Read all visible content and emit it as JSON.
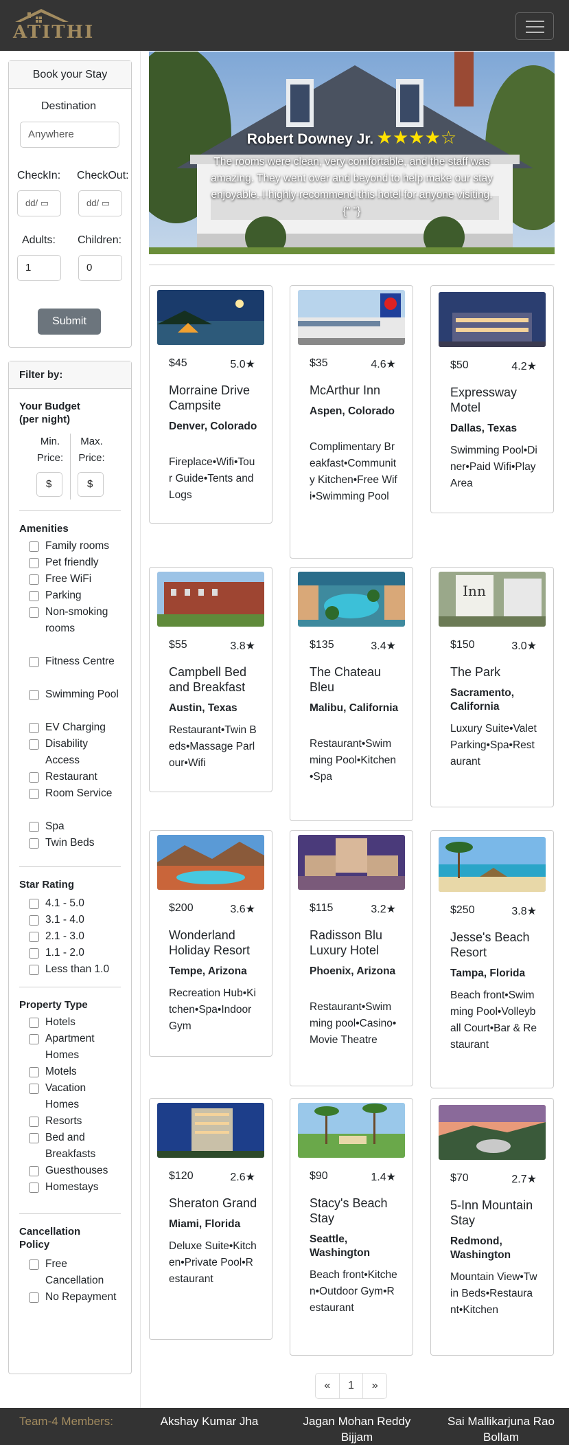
{
  "brand": {
    "name": "ATITHI"
  },
  "booking": {
    "title": "Book your Stay",
    "destination_label": "Destination",
    "destination_placeholder": "Anywhere",
    "checkin_label": "CheckIn:",
    "checkout_label": "CheckOut:",
    "date_placeholder": "dd/",
    "adults_label": "Adults:",
    "adults_value": "1",
    "children_label": "Children:",
    "children_value": "0",
    "submit_label": "Submit"
  },
  "filter": {
    "title": "Filter by:",
    "budget_title": "Your Budget (per night)",
    "min_label": "Min. Price:",
    "max_label": "Max. Price:",
    "currency": "$",
    "amenities_title": "Amenities",
    "amenities": [
      "Family rooms",
      "Pet friendly",
      "Free WiFi",
      "Parking",
      "Non-smoking rooms",
      "Fitness Centre",
      "Swimming Pool",
      "EV Charging",
      "Disability Access",
      "Restaurant",
      "Room Service",
      "Spa",
      "Twin Beds"
    ],
    "star_title": "Star Rating",
    "stars": [
      "4.1 - 5.0",
      "3.1 - 4.0",
      "2.1 - 3.0",
      "1.1 - 2.0",
      "Less than 1.0"
    ],
    "property_title": "Property Type",
    "property_types": [
      "Hotels",
      "Apartment Homes",
      "Motels",
      "Vacation Homes",
      "Resorts",
      "Bed and Breakfasts",
      "Guesthouses",
      "Homestays"
    ],
    "cancel_title": "Cancellation Policy",
    "cancel_options": [
      "Free Cancellation",
      "No Repayment"
    ]
  },
  "review": {
    "name": "Robert Downey Jr.",
    "stars": "★★★★☆",
    "quote": "The rooms were clean, very comfortable, and the staff was amazing. They went over and beyond to help make our stay enjoyable. I highly recommend this hotel for anyone visiting.{\" \"}"
  },
  "hotels": [
    {
      "price": "$45",
      "rating": "5.0★",
      "name": "Morraine Drive Campsite",
      "location": "Denver, Colorado",
      "amenities": "Fireplace•Wifi•Tour Guide•Tents and Logs",
      "img": "camp"
    },
    {
      "price": "$35",
      "rating": "4.6★",
      "name": "McArthur Inn",
      "location": "Aspen, Colorado",
      "amenities": "Complimentary Breakfast•Community Kitchen•Free Wifi•Swimming Pool",
      "img": "motel6"
    },
    {
      "price": "$50",
      "rating": "4.2★",
      "name": "Expressway Motel",
      "location": "Dallas, Texas",
      "amenities": "Swimming Pool•Diner•Paid Wifi•Play Area",
      "img": "motelnight"
    },
    {
      "price": "$55",
      "rating": "3.8★",
      "name": "Campbell Bed and Breakfast",
      "location": "Austin, Texas",
      "amenities": "Restaurant•Twin Beds•Massage Parlour•Wifi",
      "img": "brick"
    },
    {
      "price": "$135",
      "rating": "3.4★",
      "name": "The Chateau Bleu",
      "location": "Malibu, California",
      "amenities": "Restaurant•Swimming Pool•Kitchen•Spa",
      "img": "resort"
    },
    {
      "price": "$150",
      "rating": "3.0★",
      "name": "The Park",
      "location": "Sacramento, California",
      "amenities": "Luxury Suite•Valet Parking•Spa•Restaurant",
      "img": "inn"
    },
    {
      "price": "$200",
      "rating": "3.6★",
      "name": "Wonderland Holiday Resort",
      "location": "Tempe, Arizona",
      "amenities": "Recreation Hub•Kitchen•Spa•Indoor Gym",
      "img": "pool"
    },
    {
      "price": "$115",
      "rating": "3.2★",
      "name": "Radisson Blu Luxury Hotel",
      "location": "Phoenix, Arizona",
      "amenities": "Restaurant•Swimming pool•Casino•Movie Theatre",
      "img": "palace"
    },
    {
      "price": "$250",
      "rating": "3.8★",
      "name": "Jesse's Beach Resort",
      "location": "Tampa, Florida",
      "amenities": "Beach front•Swimming Pool•Volleyball Court•Bar & Restaurant",
      "img": "beach"
    },
    {
      "price": "$120",
      "rating": "2.6★",
      "name": "Sheraton Grand",
      "location": "Miami, Florida",
      "amenities": "Deluxe Suite•Kitchen•Private Pool•Restaurant",
      "img": "tower"
    },
    {
      "price": "$90",
      "rating": "1.4★",
      "name": "Stacy's Beach Stay",
      "location": "Seattle, Washington",
      "amenities": "Beach front•Kitchen•Outdoor Gym•Restaurant",
      "img": "palms"
    },
    {
      "price": "$70",
      "rating": "2.7★",
      "name": "5-Inn Mountain Stay",
      "location": "Redmond, Washington",
      "amenities": "Mountain View•Twin Beds•Restaurant•Kitchen",
      "img": "sunset"
    }
  ],
  "pagination": [
    "«",
    "1",
    "»"
  ],
  "footer": {
    "team_label": "Team-4 Members:",
    "members": [
      "Akshay Kumar Jha",
      "Jagan Mohan Reddy Bijjam",
      "Sai Mallikarjuna Rao Bollam"
    ]
  },
  "colors": {
    "navbar": "#343434",
    "brand": "#a28b5f",
    "submit": "#6c757d",
    "star": "#ffe100"
  }
}
